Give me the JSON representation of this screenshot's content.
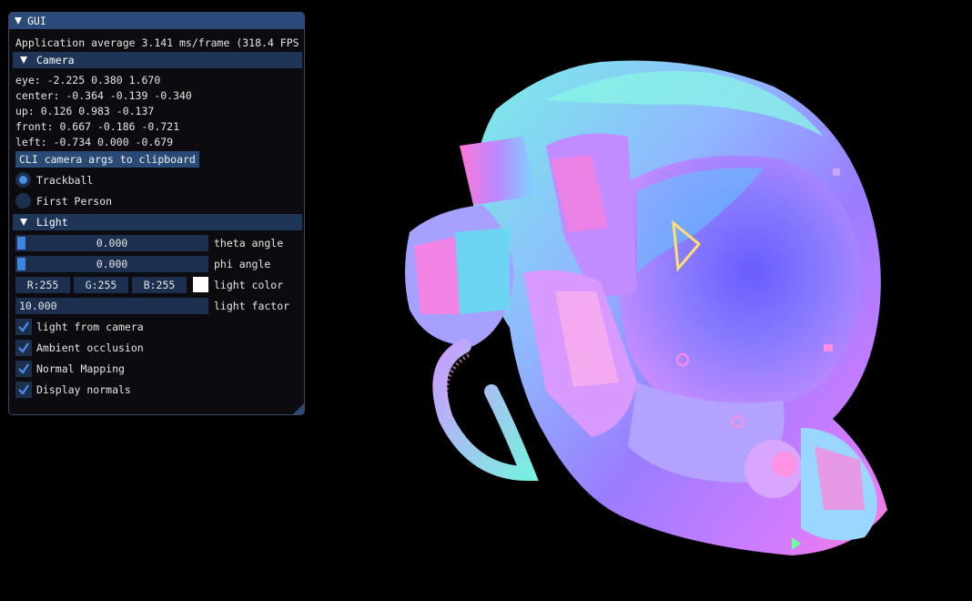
{
  "gui": {
    "title": "GUI",
    "stats": "Application average 3.141 ms/frame (318.4 FPS",
    "camera": {
      "header": "Camera",
      "eye": "eye: -2.225 0.380 1.670",
      "center": "center: -0.364 -0.139 -0.340",
      "up": "up: 0.126 0.983 -0.137",
      "front": "front: 0.667 -0.186 -0.721",
      "left": "left: -0.734 0.000 -0.679",
      "cli_button": "CLI camera args to clipboard",
      "mode_trackball": "Trackball",
      "mode_first_person": "First Person",
      "selected_mode": "Trackball"
    },
    "light": {
      "header": "Light",
      "theta_value": "0.000",
      "theta_label": "theta angle",
      "phi_value": "0.000",
      "phi_label": "phi angle",
      "r": "R:255",
      "g": "G:255",
      "b": "B:255",
      "color_label": "light color",
      "color_hex": "#ffffff",
      "factor_value": "10.000",
      "factor_label": "light factor",
      "light_from_camera": "light from camera",
      "ambient_occlusion": "Ambient occlusion",
      "normal_mapping": "Normal Mapping",
      "display_normals": "Display normals"
    }
  },
  "viewport": {
    "accent": "#4a90e8"
  }
}
